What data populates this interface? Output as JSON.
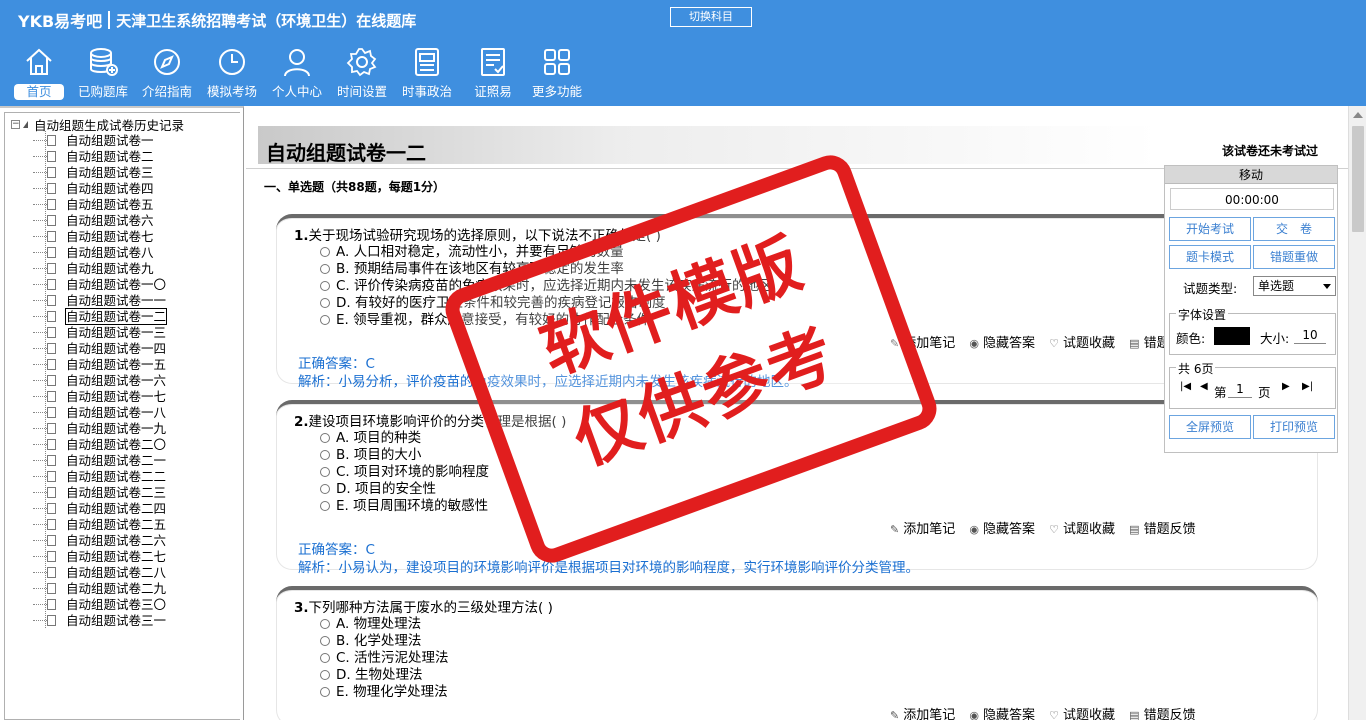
{
  "header": {
    "logo": "YKB易考吧",
    "title": "天津卫生系统招聘考试（环境卫生）在线题库",
    "switch_label": "切换科目",
    "nav": [
      {
        "label": "首页",
        "icon": "home-icon"
      },
      {
        "label": "已购题库",
        "icon": "database-icon"
      },
      {
        "label": "介绍指南",
        "icon": "compass-icon"
      },
      {
        "label": "模拟考场",
        "icon": "clock-icon"
      },
      {
        "label": "个人中心",
        "icon": "user-icon"
      },
      {
        "label": "时间设置",
        "icon": "gear-icon"
      },
      {
        "label": "时事政治",
        "icon": "news-icon"
      },
      {
        "label": "证照易",
        "icon": "checklist-icon"
      },
      {
        "label": "更多功能",
        "icon": "grid-icon"
      }
    ]
  },
  "tree": {
    "root": "自动组题生成试卷历史记录",
    "items": [
      "自动组题试卷一",
      "自动组题试卷二",
      "自动组题试卷三",
      "自动组题试卷四",
      "自动组题试卷五",
      "自动组题试卷六",
      "自动组题试卷七",
      "自动组题试卷八",
      "自动组题试卷九",
      "自动组题试卷一〇",
      "自动组题试卷一一",
      "自动组题试卷一二",
      "自动组题试卷一三",
      "自动组题试卷一四",
      "自动组题试卷一五",
      "自动组题试卷一六",
      "自动组题试卷一七",
      "自动组题试卷一八",
      "自动组题试卷一九",
      "自动组题试卷二〇",
      "自动组题试卷二一",
      "自动组题试卷二二",
      "自动组题试卷二三",
      "自动组题试卷二四",
      "自动组题试卷二五",
      "自动组题试卷二六",
      "自动组题试卷二七",
      "自动组题试卷二八",
      "自动组题试卷二九",
      "自动组题试卷三〇",
      "自动组题试卷三一"
    ],
    "selected_index": 11
  },
  "main": {
    "paper_title": "自动组题试卷一二",
    "status": "该试卷还未考试过",
    "section": "一、单选题（共88题，每题1分）",
    "tools": [
      "添加笔记",
      "隐藏答案",
      "试题收藏",
      "错题反馈"
    ],
    "questions": [
      {
        "num": "1.",
        "text": "关于现场试验研究现场的选择原则，以下说法不正确的是( )",
        "options": [
          "A. 人口相对稳定，流动性小，并要有足够的数量",
          "B. 预期结局事件在该地区有较高而稳定的发生率",
          "C. 评价传染病疫苗的免疫效果时，应选择近期内未发生该疾病流行的地区",
          "D. 有较好的医疗卫生条件和较完善的疾病登记报告制度",
          "E. 领导重视，群众愿意接受，有较好的协作配合条件"
        ],
        "answer": "正确答案：C",
        "analysis": "解析：小易分析，评价疫苗的免疫效果时，应选择近期内未发生该疾病流行的地区。"
      },
      {
        "num": "2.",
        "text": "建设项目环境影响评价的分类管理是根据( )",
        "options": [
          "A. 项目的种类",
          "B. 项目的大小",
          "C. 项目对环境的影响程度",
          "D. 项目的安全性",
          "E. 项目周围环境的敏感性"
        ],
        "answer": "正确答案：C",
        "analysis": "解析：小易认为，建设项目的环境影响评价是根据项目对环境的影响程度，实行环境影响评价分类管理。"
      },
      {
        "num": "3.",
        "text": "下列哪种方法属于废水的三级处理方法( )",
        "options": [
          "A. 物理处理法",
          "B. 化学处理法",
          "C. 活性污泥处理法",
          "D. 生物处理法",
          "E. 物理化学处理法"
        ]
      }
    ]
  },
  "panel": {
    "move": "移动",
    "timer": "00:00:00",
    "start": "开始考试",
    "submit": "交　卷",
    "card_mode": "题卡模式",
    "redo": "错题重做",
    "type_label": "试题类型:",
    "type_value": "单选题",
    "font_legend": "字体设置",
    "color_label": "颜色:",
    "size_label": "大小:",
    "size_value": "10",
    "pages_legend": "共 6页",
    "page_prefix": "第",
    "page_value": "1",
    "page_suffix": "页",
    "fullscreen": "全屏预览",
    "print": "打印预览"
  },
  "stamp": {
    "line1": "软件模版",
    "line2": "仅供参考"
  },
  "colors": {
    "header": "#3f8fdf",
    "answer": "#1a6fd1",
    "stamp": "#e11e1e"
  }
}
